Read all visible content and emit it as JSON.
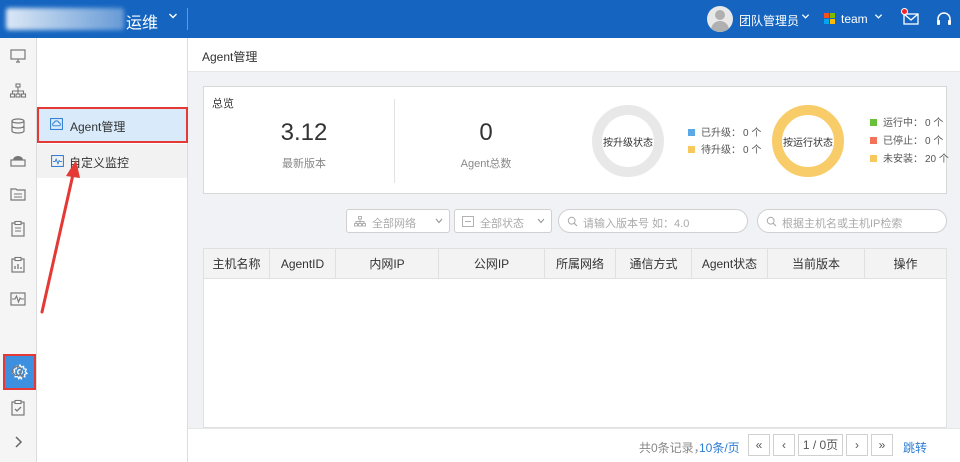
{
  "header": {
    "title_suffix": "运维",
    "user_name": "团队管理员",
    "team_name": "team",
    "caret": "⌄"
  },
  "sidebar": {
    "icons": [
      "monitor-icon",
      "topology-icon",
      "database-icon",
      "cloud-disk-icon",
      "file-list-icon",
      "clipboard-icon",
      "clipboard-chart-icon",
      "pulse-icon",
      "gear-icon",
      "search-icon",
      "checklist-icon",
      "chevron-right-icon"
    ],
    "active_icon": "gear-icon"
  },
  "subnav": {
    "items": [
      {
        "label": "Agent管理",
        "active": true
      },
      {
        "label": "自定义监控",
        "active": false
      }
    ]
  },
  "breadcrumb": "Agent管理",
  "overview": {
    "title": "总览",
    "latest_version": "3.12",
    "latest_version_label": "最新版本",
    "agent_total": "0",
    "agent_total_label": "Agent总数",
    "upgrade_donut_label": "按升级状态",
    "run_donut_label": "按运行状态",
    "upgrade_legend": [
      {
        "label": "已升级：",
        "value": "0 个",
        "color": "#5aa9e6"
      },
      {
        "label": "待升级：",
        "value": "0 个",
        "color": "#f7c85c"
      }
    ],
    "run_legend": [
      {
        "label": "运行中：",
        "value": "0 个",
        "color": "#67c23a"
      },
      {
        "label": "已停止：",
        "value": "0 个",
        "color": "#f0735a"
      },
      {
        "label": "未安装：",
        "value": "20 个",
        "color": "#f7c85c"
      }
    ],
    "upgrade_donut_color": "#e8e8e8",
    "run_donut_color": "#f9cc6a"
  },
  "filters": {
    "network": "全部网络",
    "status": "全部状态",
    "version_placeholder": "请输入版本号 如：4.0",
    "host_placeholder": "根据主机名或主机IP检索"
  },
  "table": {
    "columns": [
      "主机名称",
      "AgentID",
      "内网IP",
      "公网IP",
      "所属网络",
      "通信方式",
      "Agent状态",
      "当前版本",
      "操作"
    ]
  },
  "pager": {
    "info": "共0条记录，",
    "page_size": "10条/页",
    "first": "«",
    "prev": "‹",
    "page": "1 / 0页",
    "next": "›",
    "last": "»",
    "jump": "跳转"
  },
  "colors": {
    "topbar": "#1565c0",
    "accent": "#3d8fe0",
    "highlight": "#e53935"
  }
}
